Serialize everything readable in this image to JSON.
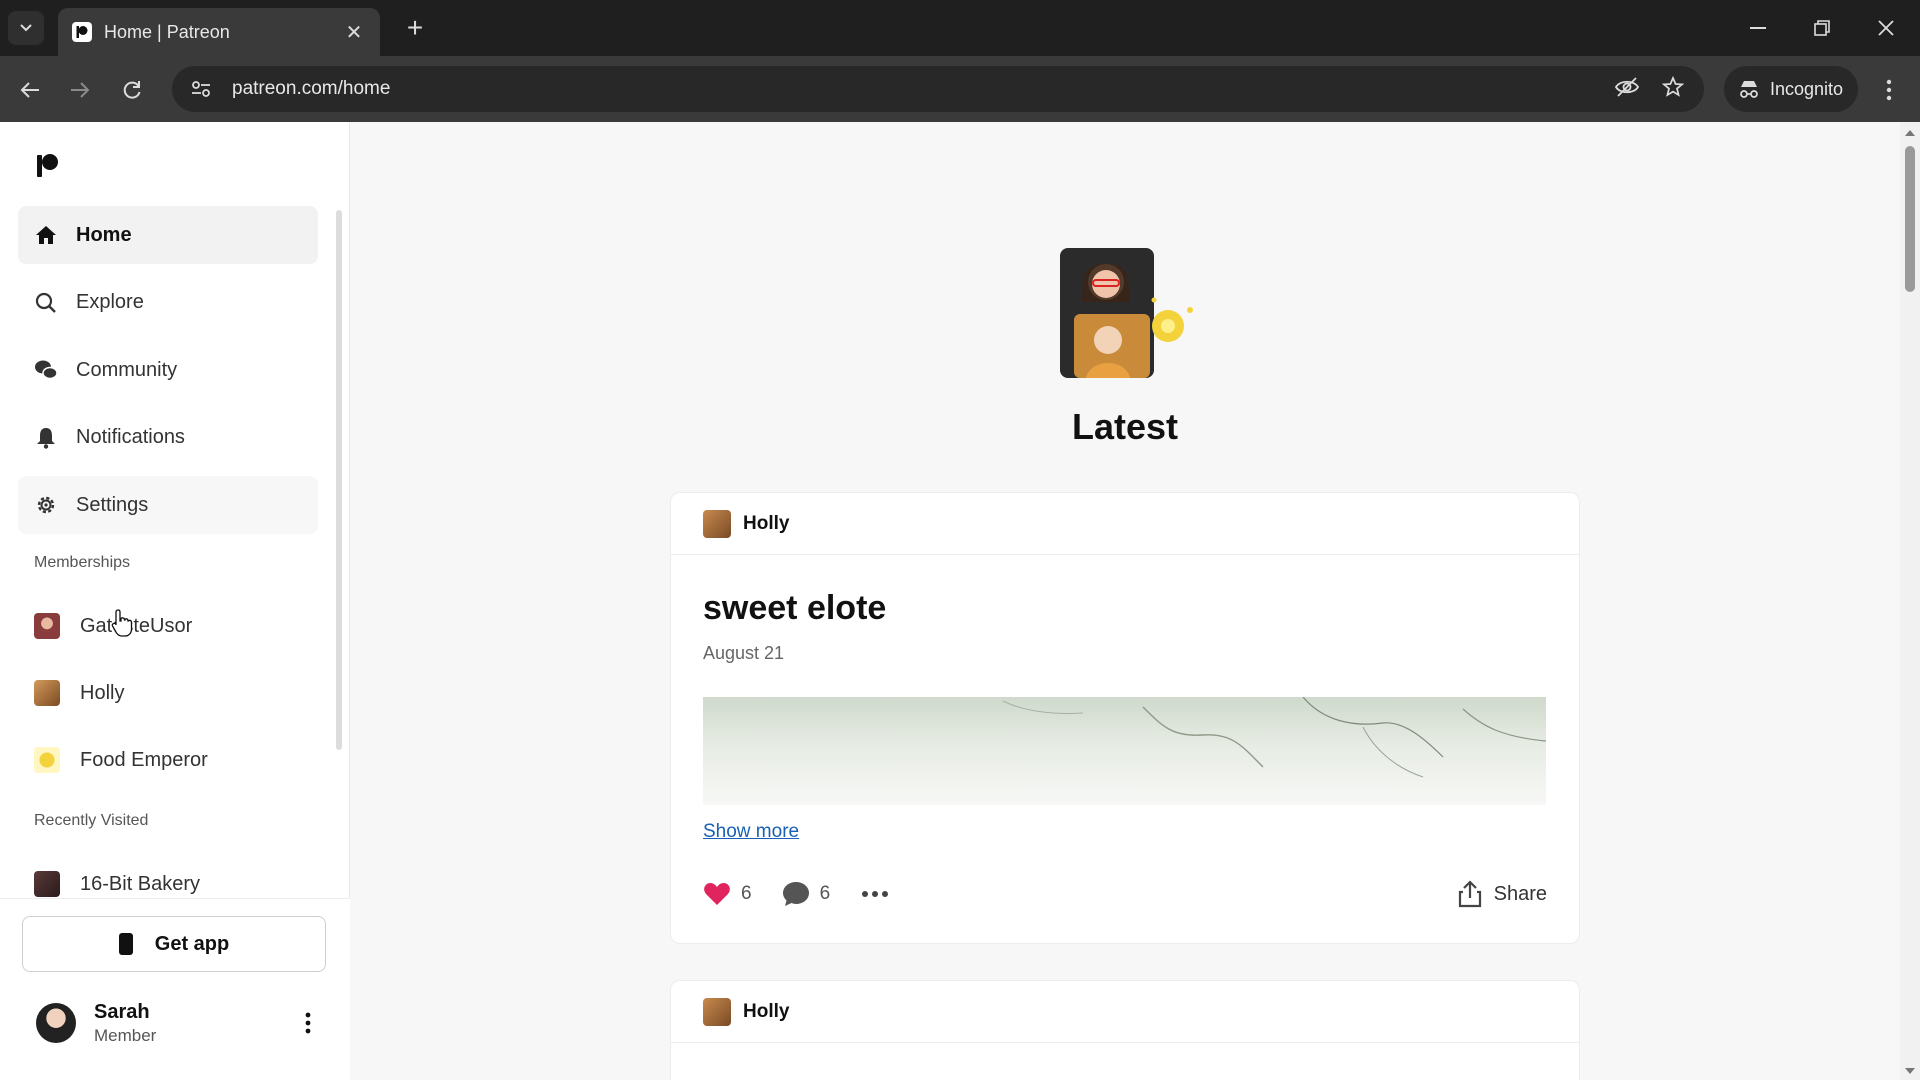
{
  "browser": {
    "tab_title": "Home | Patreon",
    "url": "patreon.com/home",
    "incognito_label": "Incognito",
    "new_tab_glyph": "+",
    "close_glyph": "✕"
  },
  "sidebar": {
    "nav": [
      {
        "label": "Home",
        "icon": "home-icon",
        "active": true
      },
      {
        "label": "Explore",
        "icon": "search-icon"
      },
      {
        "label": "Community",
        "icon": "chat-bubbles-icon"
      },
      {
        "label": "Notifications",
        "icon": "bell-icon"
      },
      {
        "label": "Settings",
        "icon": "gear-icon"
      }
    ],
    "memberships_label": "Memberships",
    "memberships": [
      {
        "label": "GatesteUsor"
      },
      {
        "label": "Holly"
      },
      {
        "label": "Food Emperor"
      }
    ],
    "recently_visited_label": "Recently Visited",
    "recently_visited": [
      {
        "label": "16-Bit Bakery"
      }
    ],
    "get_app_label": "Get app",
    "user": {
      "name": "Sarah",
      "role": "Member"
    }
  },
  "main": {
    "title": "Latest",
    "posts": [
      {
        "creator": "Holly",
        "title": "sweet elote",
        "date": "August 21",
        "show_more": "Show more",
        "likes": "6",
        "comments": "6",
        "share_label": "Share"
      },
      {
        "creator": "Holly"
      }
    ]
  },
  "colors": {
    "like": "#e0245e",
    "link": "#1a5fb4"
  }
}
